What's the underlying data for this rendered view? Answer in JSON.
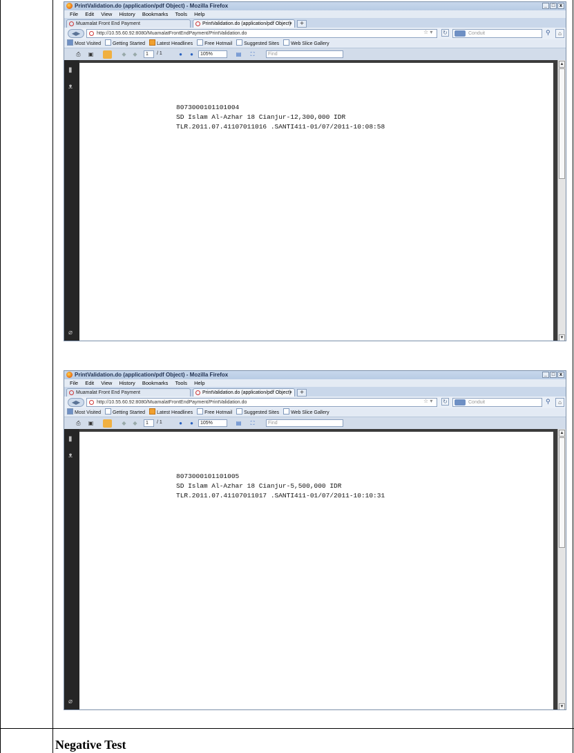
{
  "browser": {
    "title": "PrintValidation.do (application/pdf Object) - Mozilla Firefox",
    "window_buttons": [
      "_",
      "□",
      "x"
    ],
    "menu": [
      "File",
      "Edit",
      "View",
      "History",
      "Bookmarks",
      "Tools",
      "Help"
    ],
    "tabs": [
      {
        "label": "Muamalat Front End Payment"
      },
      {
        "label": "PrintValidation.do (application/pdf Object)",
        "close": "×"
      }
    ],
    "new_tab": "+",
    "url": "http://10.55.60.92:8080/MuamalatFrontEndPayment/PrintValidation.do",
    "search_placeholder": "Conduit",
    "bookmarks": [
      "Most Visited",
      "Getting Started",
      "Latest Headlines",
      "Free Hotmail",
      "Suggested Sites",
      "Web Slice Gallery"
    ],
    "pdf_toolbar": {
      "page_value": "1",
      "page_total": "/ 1",
      "zoom": "105%",
      "find_placeholder": "Find"
    }
  },
  "screens": [
    {
      "lines": [
        "8073000101101004",
        "SD Islam Al-Azhar 18 Cianjur-12,300,000 IDR",
        "TLR.2011.07.41107011016 .SANTI411-01/07/2011-10:08:58"
      ]
    },
    {
      "lines": [
        "8073000101101005",
        "SD Islam Al-Azhar 18 Cianjur-5,500,000 IDR",
        "TLR.2011.07.41107011017 .SANTI411-01/07/2011-10:10:31"
      ]
    }
  ],
  "section_title": "Negative Test"
}
